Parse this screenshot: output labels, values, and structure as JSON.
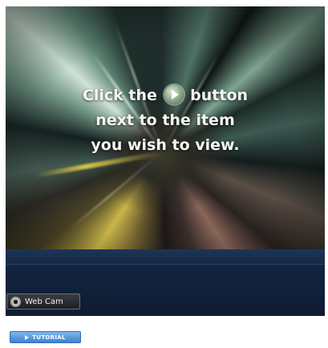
{
  "viewer": {
    "instruction": {
      "line1_before": "Click the",
      "line1_after": "button",
      "line2": "next to the item",
      "line3": "you wish to view."
    },
    "play_icon": "play-circle-icon",
    "webcam": {
      "label": "Web Cam",
      "icon": "webcam-icon"
    }
  },
  "tutorial": {
    "label": "TUTORIAL",
    "icon": "play-arrow-icon"
  },
  "colors": {
    "lower_band": "#12243e",
    "tutorial_button": "#3f82cf",
    "instruction_text": "#f4f6f2"
  }
}
